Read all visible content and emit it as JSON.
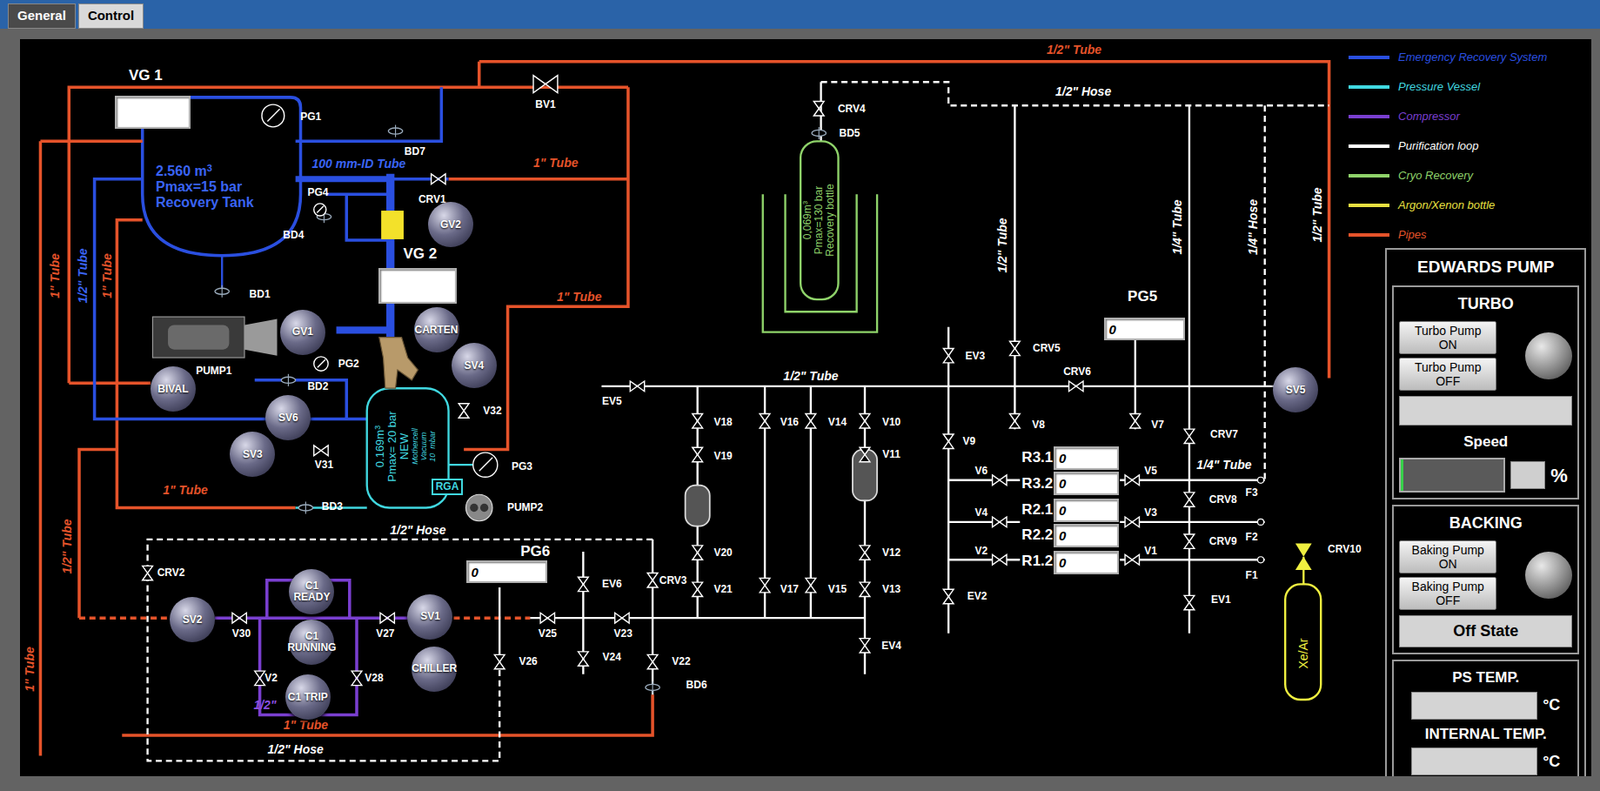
{
  "tabs": [
    {
      "label": "General",
      "selected": true
    },
    {
      "label": "Control",
      "selected": false
    }
  ],
  "legend": [
    {
      "label": "Emergency Recovery System",
      "color": "#2a4fe0"
    },
    {
      "label": "Pressure Vessel",
      "color": "#40d8e0"
    },
    {
      "label": "Compressor",
      "color": "#7a3fd0"
    },
    {
      "label": "Purification loop",
      "color": "#ffffff"
    },
    {
      "label": "Cryo Recovery",
      "color": "#8fd36a"
    },
    {
      "label": "Argon/Xenon bottle",
      "color": "#e8e040"
    },
    {
      "label": "Pipes",
      "color": "#e5532a"
    }
  ],
  "tags": [
    "PG1",
    "BD7",
    "PG4",
    "CRV1",
    "BD4",
    "BD1",
    "PUMP1",
    "PG2",
    "BD2",
    "V32",
    "V31",
    "PG3",
    "PUMP2",
    "BD3",
    "BV1",
    "CRV4",
    "BD5",
    "EV3",
    "CRV5",
    "CRV6",
    "EV5",
    "V18",
    "V19",
    "V16",
    "V14",
    "V10",
    "V11",
    "V9",
    "V8",
    "V7",
    "CRV7",
    "CRV8",
    "CRV9",
    "CRV10",
    "F3",
    "F2",
    "F1",
    "EV1",
    "V6",
    "V5",
    "V4",
    "V3",
    "V2",
    "V1",
    "V20",
    "V21",
    "V17",
    "V15",
    "V12",
    "V13",
    "EV4",
    "EV2",
    "CRV2",
    "V30",
    "V27",
    "V28",
    "V2",
    "EV6",
    "V25",
    "V23",
    "V24",
    "V26",
    "CRV3",
    "V22",
    "BD6"
  ],
  "pipe_labels": [
    "1/2\" Tube",
    "1/2\" Hose",
    "100 mm-ID Tube",
    "1\" Tube",
    "1\" Tube",
    "1\" Tube",
    "1/2\" Tube",
    "1\" Tube",
    "1\" Tube",
    "1/2\" Tube",
    "1\" Tube",
    "1/2\" Tube",
    "1/2\" Tube",
    "1/4\" Tube",
    "1/4\" Tube",
    "1/4\" Hose",
    "1/2\" Tube",
    "1/2\" Hose",
    "1\" Tube",
    "1/2\" Hose",
    "1/2\""
  ],
  "spheres": [
    "GV2",
    "GV1",
    "CARTEN",
    "SV4",
    "BIVAL",
    "SV6",
    "SV3",
    "SV2",
    "C1 READY",
    "C1 RUNNING",
    "C1 TRIP",
    "SV1",
    "CHILLER",
    "SV5"
  ],
  "displays": [
    {
      "label": "VG 1",
      "value": ""
    },
    {
      "label": "VG 2",
      "value": ""
    },
    {
      "label": "PG5",
      "value": "0"
    },
    {
      "label": "PG6",
      "value": "0"
    },
    {
      "label": "R3.1",
      "value": "0"
    },
    {
      "label": "R3.2",
      "value": "0"
    },
    {
      "label": "R2.1",
      "value": "0"
    },
    {
      "label": "R2.2",
      "value": "0"
    },
    {
      "label": "R1.2",
      "value": "0"
    }
  ],
  "rga": "RGA",
  "vessels": {
    "recovery_tank": {
      "volume": "2.560 m",
      "power": "3",
      "pmax": "Pmax=15 bar",
      "name": "Recovery Tank"
    },
    "mothercell": {
      "volume": "0.169m",
      "power": "3",
      "pmax": "Pmax= 20 bar",
      "tag": "NEW",
      "notes": [
        "Mothercell",
        "Vacuum",
        "10  mbar"
      ]
    },
    "recovery_bottle": {
      "volume": "0,069m",
      "power": "3",
      "pmax": "Pmax=130 bar",
      "name": "Recovery bottle"
    },
    "gas_bottle": {
      "name": "Xe/Ar"
    }
  },
  "pump_panel": {
    "title": "EDWARDS PUMP",
    "turbo": {
      "title": "TURBO",
      "buttons": [
        "Turbo Pump ON",
        "Turbo Pump OFF"
      ],
      "lamp_on": false,
      "status": "",
      "speed_label": "Speed",
      "speed_level": 0.02,
      "speed_value": "",
      "speed_unit": "%"
    },
    "backing": {
      "title": "BACKING",
      "buttons": [
        "Baking Pump ON",
        "Baking Pump OFF"
      ],
      "lamp_on": false,
      "status": "Off State"
    },
    "temperatures": [
      {
        "label": "PS TEMP.",
        "value": "",
        "unit": "°C"
      },
      {
        "label": "INTERNAL TEMP.",
        "value": "",
        "unit": "°C"
      }
    ]
  }
}
